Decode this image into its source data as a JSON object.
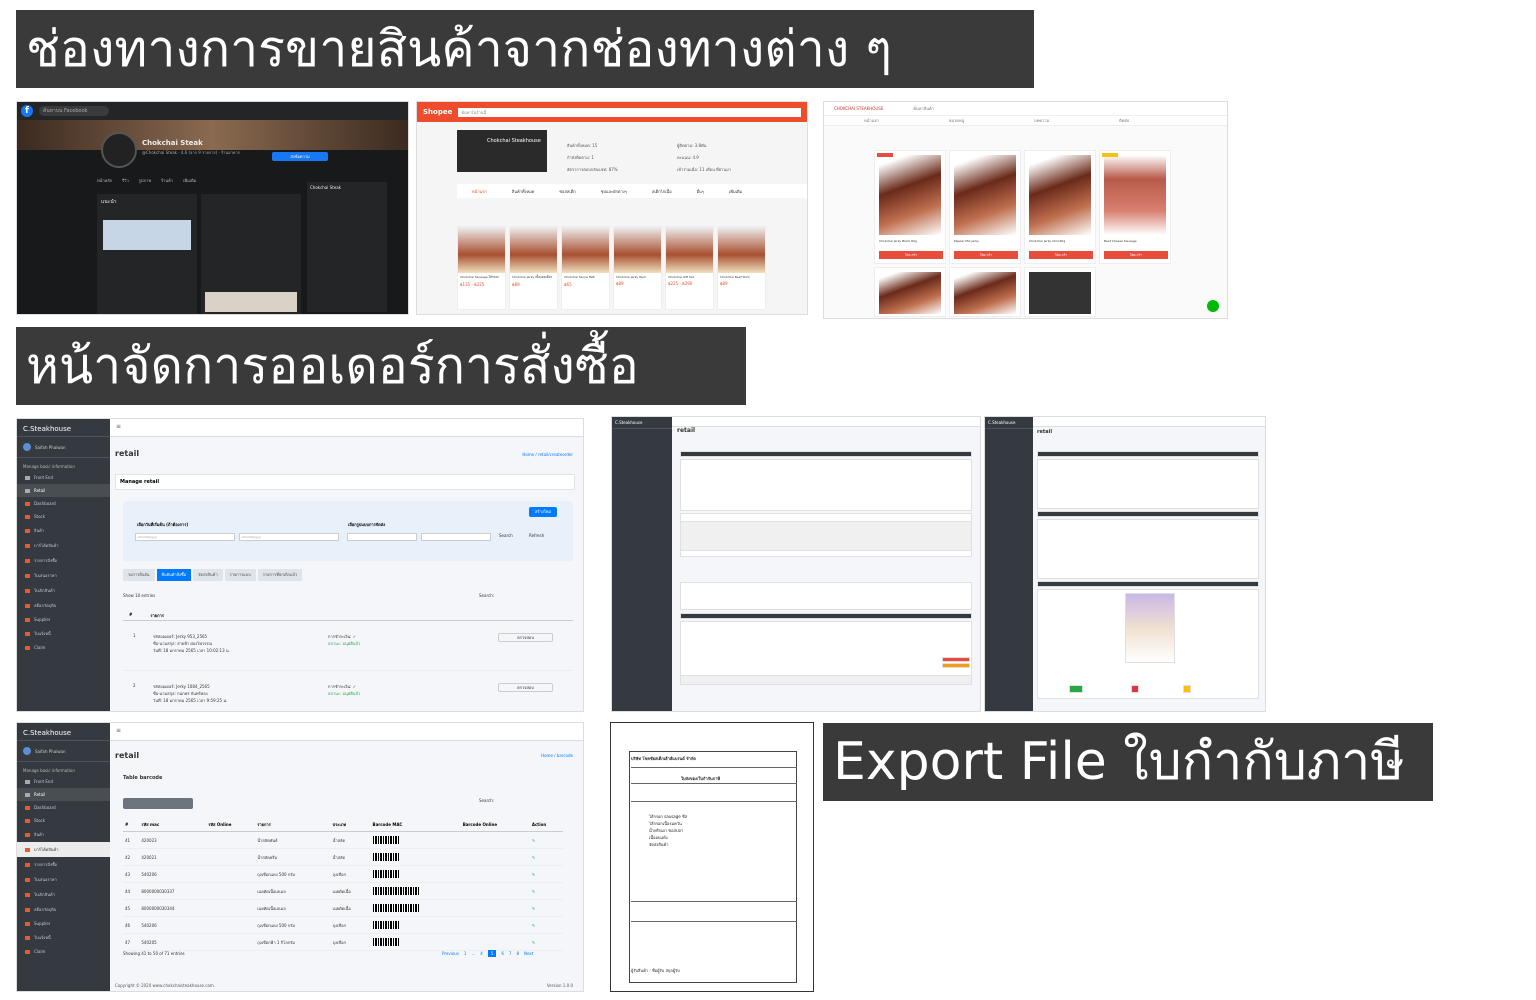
{
  "banners": {
    "channels": "ช่องทางการขายสินค้าจากช่องทางต่าง ๆ",
    "order_mgmt": "หน้าจัดการออเดอร์การสั่งซื้อ",
    "export": "Export File ใบกำกับภาษี"
  },
  "facebook": {
    "logo": "f",
    "search_placeholder": "ค้นหาบน Facebook",
    "page_name": "Chokchai Steak",
    "page_sub": "@Chokchai Steak · 4.6 (จาก 9 รายการ) · ร้านอาหาร",
    "message_button": "ส่งข้อความ",
    "tabs": [
      "หน้าหลัก",
      "รีวิว",
      "รูปภาพ",
      "ร้านค้า",
      "เพิ่มเติม"
    ],
    "intro_title": "แนะนำ",
    "chat_title": "Chokchai Steak"
  },
  "shopee": {
    "brand": "Shopee",
    "search_placeholder": "ค้นหาในร้านนี้",
    "shop_name": "Chokchai Steakhouse",
    "stats": [
      "สินค้าทั้งหมด: 15",
      "กำลังติดตาม: 1",
      "อัตราการตอบกลับแชท: 87%",
      "ผู้ติดตาม: 3.8พัน",
      "คะแนน: 4.9",
      "เข้าร่วมเมื่อ: 11 เดือน ที่ผ่านมา"
    ],
    "tabs": [
      "หน้าแรก",
      "สินค้าทั้งหมด",
      "ซอสสเต็ก",
      "ซุปและผักต่างๆ",
      "สเต็กไก่เนื้อ",
      "อื่นๆ",
      "เพิ่มเติม"
    ],
    "products": [
      {
        "title": "Chokchai Sausage ไส้กรอก",
        "price": "฿135 - ฿225"
      },
      {
        "title": "Chokchai Jerky เนื้อแดดเดียว",
        "price": "฿89"
      },
      {
        "title": "Chokchai Sauce ซอส",
        "price": "฿65"
      },
      {
        "title": "Chokchai Jerky Pack",
        "price": "฿89"
      },
      {
        "title": "Chokchai Gift Set",
        "price": "฿225 - ฿290"
      },
      {
        "title": "Chokchai Beef Stick",
        "price": "฿89"
      }
    ]
  },
  "line_shop": {
    "brand": "CHOKCHAI STEAKHOUSE",
    "search_placeholder": "ค้นหาสินค้า",
    "nav": [
      "หน้าแรก",
      "หมวดหมู่",
      "บทความ",
      "ติดต่อ"
    ],
    "cart_label": "ใส่ตะกร้า",
    "products": [
      "Chokchai Jerky Black 60g",
      "Pepper Mix Jerky",
      "Chokchai Jerky Chili 60g",
      "Beef Cheese Sausage"
    ]
  },
  "order_mgmt": {
    "brand": "C.Steakhouse",
    "user": "Saifah Phaiwan",
    "menu_header": "Manage basic information",
    "menu": [
      "Front End",
      "Retail",
      "Dashboard",
      "Stock",
      "สินค้า",
      "บาร์โค้ดสินค้า",
      "รายการสั่งซื้อ",
      "ใบเสนอราคา",
      "ใบเบิกสินค้า",
      "สต็อกวัตถุดิบ",
      "Supplier",
      "ใบแจ้งหนี้",
      "Claim"
    ],
    "page_title": "retail",
    "breadcrumb": "Home / retail/createorder",
    "card_title": "Manage retail",
    "new_button": "สร้างใหม่",
    "date_from_label": "เลือกวันที่เริ่มต้น (ถ้าต้องการ)",
    "status_label": "เลือกรูปแบบการจัดส่ง",
    "date_placeholder": "mm/dd/yyyy",
    "search_button": "Search",
    "refresh_button": "Refresh",
    "status_tabs": [
      "รอการยืนยัน",
      "ยืนยันคำสั่งซื้อ",
      "จัดส่งสินค้า",
      "รายการแบบ",
      "รายการที่ยกเลิกแล้ว"
    ],
    "show_entries": "Show 10 entries",
    "search_label": "Search:",
    "col_no": "#",
    "col_item": "รายการ",
    "rows": [
      {
        "no": "1",
        "line1": "รหัสออเดอร์: Jerky 953_2565",
        "line2": "ชื่อ-นามสกุล: สายฟ้า ผ่องไพวรรณ",
        "line3": "วันที่: 18 มกราคม 2565 เวลา 10:02:13 น.",
        "status1": "การชำระเงิน: ✓",
        "status2": "สถานะ: อนุมัติแล้ว",
        "action": "ตรวจสอบ"
      },
      {
        "no": "2",
        "line1": "รหัสออเดอร์: Jerky 1084_2565",
        "line2": "ชื่อ-นามสกุล: กนกพร จันทร์ทอง",
        "line3": "วันที่: 18 มกราคม 2565 เวลา 9:59:25 น.",
        "status1": "การชำระเงิน: ✓",
        "status2": "สถานะ: อนุมัติแล้ว",
        "action": "ตรวจสอบ"
      }
    ]
  },
  "order_form": {
    "brand": "C.Steakhouse",
    "page_title": "retail"
  },
  "order_detail": {
    "brand": "C.Steakhouse",
    "page_title": "retail"
  },
  "barcode": {
    "brand": "C.Steakhouse",
    "user": "Saifah Phaiwan",
    "menu_header": "Manage basic information",
    "menu": [
      "Front End",
      "Retail",
      "Dashboard",
      "Stock",
      "สินค้า",
      "บาร์โค้ดสินค้า",
      "รายการสั่งซื้อ",
      "ใบเสนอราคา",
      "ใบเบิกสินค้า",
      "สต็อกวัตถุดิบ",
      "Supplier",
      "ใบแจ้งหนี้",
      "Claim"
    ],
    "page_title": "retail",
    "breadcrumb": "Home / barcode",
    "card_title": "Table barcode",
    "search_label": "Search:",
    "headers": [
      "#",
      "รหัส mac",
      "รหัส Online",
      "รายการ",
      "ประเภท",
      "Barcode MAC",
      "Barcode Online",
      "Action"
    ],
    "rows": [
      {
        "no": "41",
        "mac": "420023",
        "online": "",
        "item": "น้ำสลัดพันธ์",
        "type": "น้ำสลัด",
        "long": false
      },
      {
        "no": "42",
        "mac": "420021",
        "online": "",
        "item": "น้ำสลัดครีม",
        "type": "น้ำสลัด",
        "long": false
      },
      {
        "no": "43",
        "mac": "540206",
        "online": "",
        "item": "ถุงเชือกแดง 500 กรัม",
        "type": "ถุงเชือก",
        "long": false
      },
      {
        "no": "44",
        "mac": "8000000030337",
        "online": "",
        "item": "เนยตัดเนื้อเลเมล",
        "type": "เนยตัดเนื้อ",
        "long": true
      },
      {
        "no": "45",
        "mac": "8000000030344",
        "online": "",
        "item": "เนยตัดเนื้อเลเมล",
        "type": "เนยตัดเนื้อ",
        "long": true
      },
      {
        "no": "46",
        "mac": "540206",
        "online": "",
        "item": "ถุงเชือกแดง 500 กรัม",
        "type": "ถุงเชือก",
        "long": false
      },
      {
        "no": "47",
        "mac": "540205",
        "online": "",
        "item": "ถุงเชือกฟ้า 1 กิโลกรัม",
        "type": "ถุงเชือก",
        "long": false
      }
    ],
    "footer": "Showing 41 to 50 of 71 entries",
    "pager": [
      "Previous",
      "1",
      "...",
      "4",
      "5",
      "6",
      "7",
      "8",
      "Next"
    ],
    "pager_current": "5",
    "copyright": "Copyright © 2020 www.chokchaisteakhouse.com.",
    "version": "Version 1.0.0"
  },
  "tax_invoice": {
    "company": "บริษัท โชคชัยสเต็กเฮ้าส์แบรนด์ จำกัด",
    "doc_title": "ใบส่งของ/ใบกำกับภาษี",
    "items": [
      "ไส้กรอก sausage ชีส",
      "ไส้กรอกเนื้อรมควัน",
      "น้ำพริกเผา ซอสปลา",
      "เนื้ออบแห้ง",
      "จัดส่งสินค้า"
    ],
    "signature": "ผู้รับสินค้า : ชื่อผู้รับ สกุลผู้รับ"
  }
}
